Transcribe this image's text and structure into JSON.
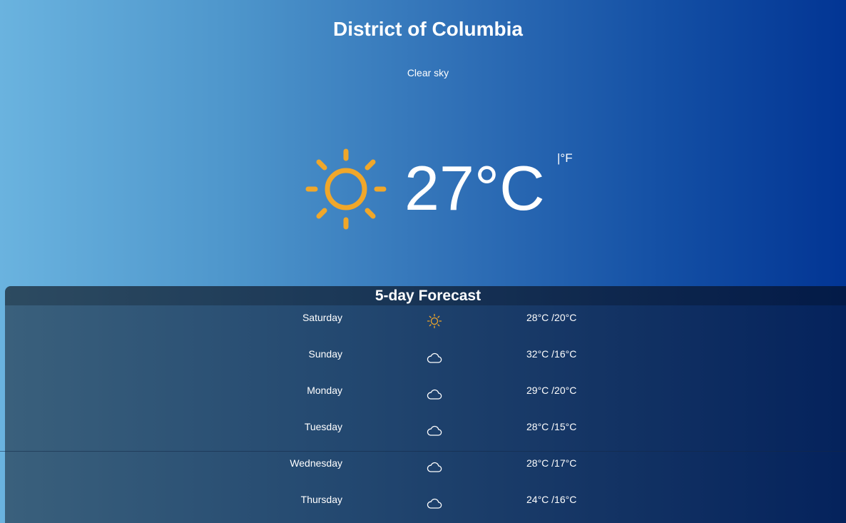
{
  "location": {
    "name": "District of Columbia"
  },
  "current": {
    "condition": "Clear sky",
    "temperature": "27°C",
    "unit_toggle": "|°F",
    "icon": "sun-icon"
  },
  "forecast": {
    "title": "5-day Forecast",
    "days": [
      {
        "day": "Saturday",
        "icon": "sun-icon",
        "temps": "28°C /20°C"
      },
      {
        "day": "Sunday",
        "icon": "cloud-icon",
        "temps": "32°C /16°C"
      },
      {
        "day": "Monday",
        "icon": "cloud-icon",
        "temps": "29°C /20°C"
      },
      {
        "day": "Tuesday",
        "icon": "cloud-icon",
        "temps": "28°C /15°C"
      },
      {
        "day": "Wednesday",
        "icon": "cloud-icon",
        "temps": "28°C /17°C"
      },
      {
        "day": "Thursday",
        "icon": "cloud-icon",
        "temps": "24°C /16°C"
      }
    ]
  },
  "colors": {
    "sun": "#f0a72a",
    "text": "#ffffff",
    "gradient_start": "#6ab3df",
    "gradient_end": "#023594"
  }
}
